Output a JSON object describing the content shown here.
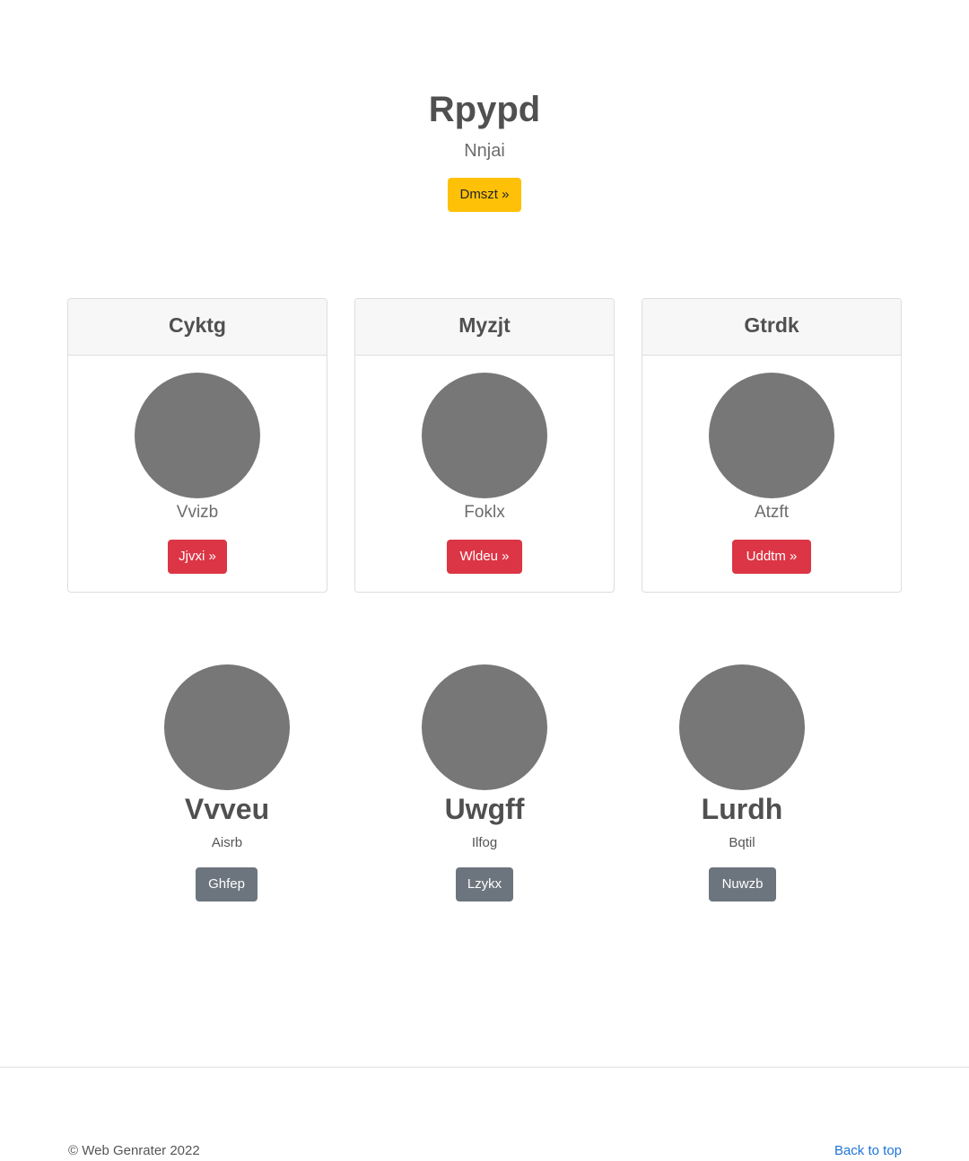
{
  "hero": {
    "title": "Rpypd",
    "subtitle": "Nnjai",
    "button_label": "Dmszt »"
  },
  "cards": [
    {
      "header": "Cyktg",
      "text": "Vvizb",
      "button_label": "Jjvxi »"
    },
    {
      "header": "Myzjt",
      "text": "Foklx",
      "button_label": "Wldeu »"
    },
    {
      "header": "Gtrdk",
      "text": "Atzft",
      "button_label": "Uddtm »"
    }
  ],
  "features": [
    {
      "title": "Vvveu",
      "text": "Aisrb",
      "button_label": "Ghfep"
    },
    {
      "title": "Uwgff",
      "text": "Ilfog",
      "button_label": "Lzykx"
    },
    {
      "title": "Lurdh",
      "text": "Bqtil",
      "button_label": "Nuwzb"
    }
  ],
  "footer": {
    "copyright": "© Web Genrater 2022",
    "back_to_top": "Back to top"
  },
  "colors": {
    "warning": "#ffc107",
    "danger": "#dc3545",
    "secondary": "#6c757d",
    "link": "#1e73d8",
    "placeholder": "#777777"
  }
}
